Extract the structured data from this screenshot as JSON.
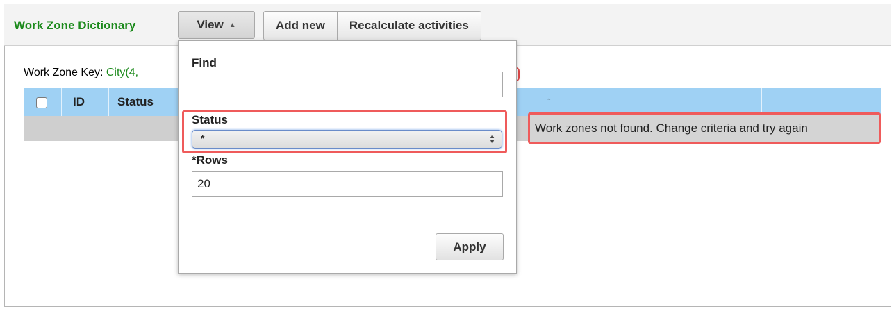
{
  "header": {
    "title": "Work Zone Dictionary",
    "view_label": "View",
    "view_caret_icon": "caret-up-icon",
    "add_new_label": "Add new",
    "recalculate_label": "Recalculate activities"
  },
  "main": {
    "key_label": "Work Zone Key:",
    "key_value": "City(4,",
    "grid": {
      "columns": [
        "ID",
        "Status"
      ],
      "sort_indicator": "↑",
      "empty_message": "Work zones not found. Change criteria and try again"
    }
  },
  "view_menu": {
    "find_label": "Find",
    "find_value": "",
    "status_label": "Status",
    "status_value": "*",
    "rows_label": "*Rows",
    "rows_value": "20",
    "apply_label": "Apply"
  },
  "colors": {
    "title_green": "#1c8a1c",
    "grid_header": "#9fd1f4",
    "highlight_red": "#ef5b5b"
  }
}
